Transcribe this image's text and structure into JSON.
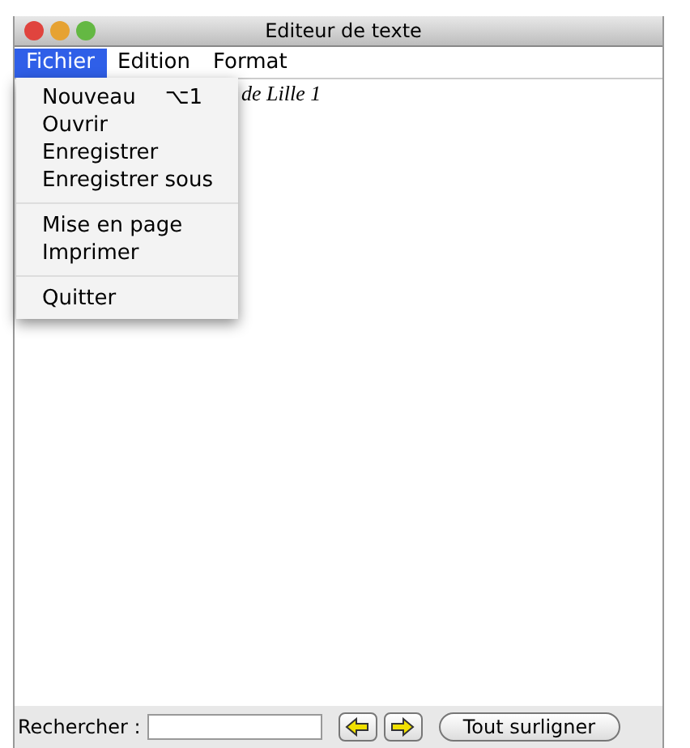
{
  "window": {
    "title": "Editeur de texte"
  },
  "menubar": [
    {
      "label": "Fichier",
      "selected": true
    },
    {
      "label": "Edition",
      "selected": false
    },
    {
      "label": "Format",
      "selected": false
    }
  ],
  "menu": [
    {
      "kind": "item",
      "label": "Nouveau",
      "shortcut": "⌥1"
    },
    {
      "kind": "item",
      "label": "Ouvrir"
    },
    {
      "kind": "item",
      "label": "Enregistrer"
    },
    {
      "kind": "item",
      "label": "Enregistrer sous"
    },
    {
      "kind": "separator"
    },
    {
      "kind": "item",
      "label": "Mise en page"
    },
    {
      "kind": "item",
      "label": "Imprimer"
    },
    {
      "kind": "separator"
    },
    {
      "kind": "item",
      "label": "Quitter"
    }
  ],
  "editor": {
    "text": "de Lille 1"
  },
  "search_bar": {
    "label": "Rechercher :",
    "highlight_button": "Tout surligner"
  }
}
